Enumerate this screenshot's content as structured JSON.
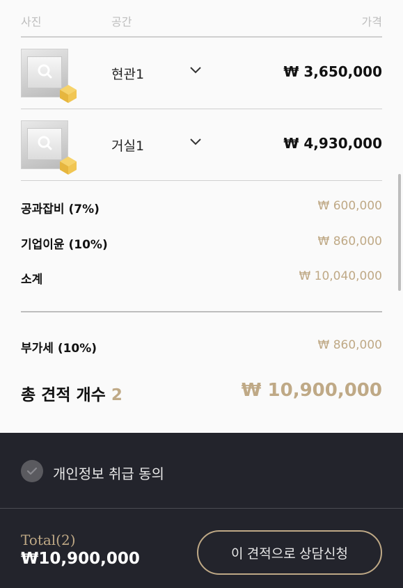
{
  "header": {
    "photo": "사진",
    "space": "공간",
    "price": "가격"
  },
  "items": [
    {
      "name": "현관1",
      "price": "₩ 3,650,000",
      "thumb_icon": "room-thumbnail-entrance"
    },
    {
      "name": "거실1",
      "price": "₩ 4,930,000",
      "thumb_icon": "room-thumbnail-living"
    }
  ],
  "summary": [
    {
      "label": "공과잡비 (7%)",
      "value": "₩ 600,000"
    },
    {
      "label": "기업이윤 (10%)",
      "value": "₩ 860,000"
    },
    {
      "label": "소계",
      "value": "₩ 10,040,000"
    }
  ],
  "vat": {
    "label": "부가세 (10%)",
    "value": "₩ 860,000"
  },
  "estimate_total": {
    "label": "총 견적 개수",
    "count": "2",
    "value": "₩ 10,900,000"
  },
  "consent": {
    "label": "개인정보 취급 동의",
    "checked": false
  },
  "footer": {
    "total_label": "Total(2)",
    "total_amount": "₩10,900,000",
    "cta_label": "이 견적으로 상담신청"
  },
  "colors": {
    "accent": "#bfa986",
    "dark_bg": "#23242c",
    "page_bg": "#fafafa"
  }
}
